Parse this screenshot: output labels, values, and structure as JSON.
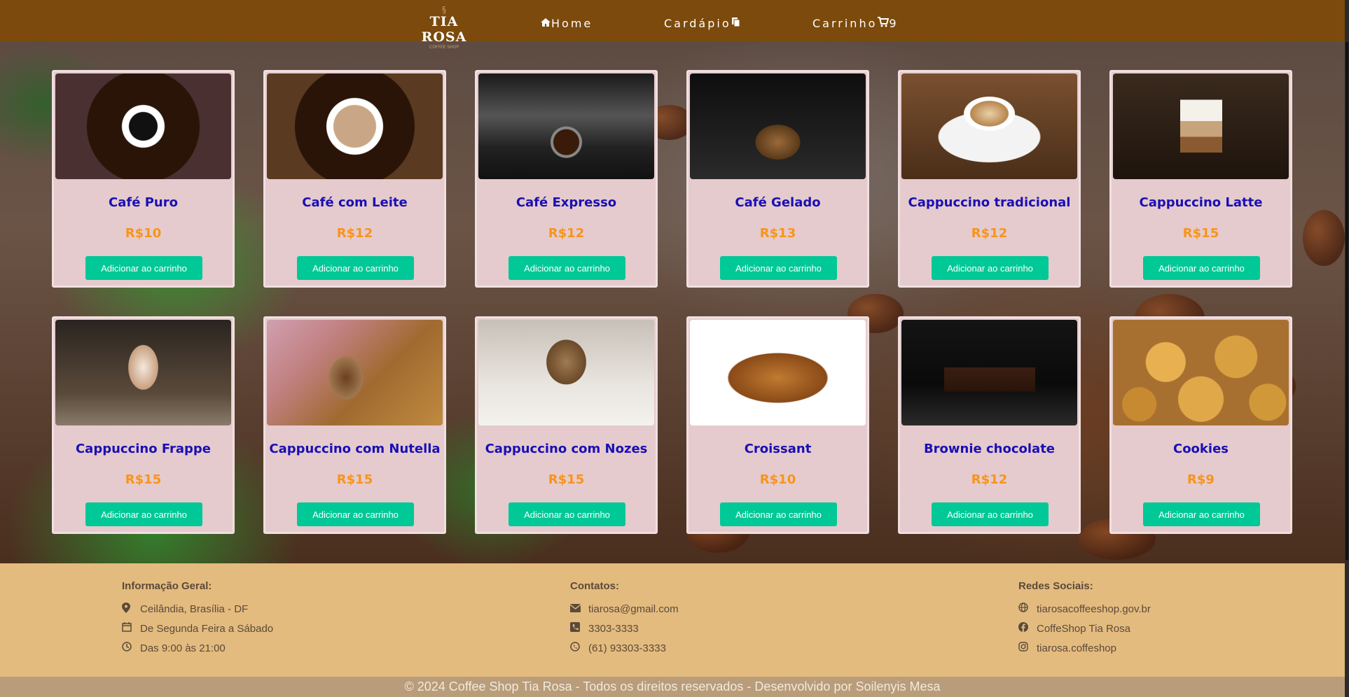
{
  "navbar": {
    "logo": "TIA ROSA",
    "logo_sub": "COFFEE SHOP",
    "links": {
      "home": "Home",
      "cardapio": "Cardápio",
      "carrinho": "Carrinho",
      "cart_count": "9"
    }
  },
  "products": [
    {
      "name": "Café Puro",
      "price": "R$10",
      "button": "Adicionar ao carrinho"
    },
    {
      "name": "Café com Leite",
      "price": "R$12",
      "button": "Adicionar ao carrinho"
    },
    {
      "name": "Café Expresso",
      "price": "R$12",
      "button": "Adicionar ao carrinho"
    },
    {
      "name": "Café Gelado",
      "price": "R$13",
      "button": "Adicionar ao carrinho"
    },
    {
      "name": "Cappuccino tradicional",
      "price": "R$12",
      "button": "Adicionar ao carrinho"
    },
    {
      "name": "Cappuccino Latte",
      "price": "R$15",
      "button": "Adicionar ao carrinho"
    },
    {
      "name": "Cappuccino Frappe",
      "price": "R$15",
      "button": "Adicionar ao carrinho"
    },
    {
      "name": "Cappuccino com Nutella",
      "price": "R$15",
      "button": "Adicionar ao carrinho"
    },
    {
      "name": "Cappuccino com Nozes",
      "price": "R$15",
      "button": "Adicionar ao carrinho"
    },
    {
      "name": "Croissant",
      "price": "R$10",
      "button": "Adicionar ao carrinho"
    },
    {
      "name": "Brownie chocolate",
      "price": "R$12",
      "button": "Adicionar ao carrinho"
    },
    {
      "name": "Cookies",
      "price": "R$9",
      "button": "Adicionar ao carrinho"
    }
  ],
  "footer": {
    "info": {
      "title": "Informação Geral:",
      "address": "Ceilândia, Brasília - DF",
      "days": "De Segunda Feira a Sábado",
      "hours": "Das 9:00 às 21:00"
    },
    "contacts": {
      "title": "Contatos:",
      "email": "tiarosa@gmail.com",
      "phone": "3303-3333",
      "whatsapp": "(61) 93303-3333"
    },
    "social": {
      "title": "Redes Sociais:",
      "website": "tiarosacoffeeshop.gov.br",
      "facebook": "CoffeShop Tia Rosa",
      "instagram": "tiarosa.coffeshop"
    },
    "copyright": "© 2024 Coffee Shop Tia Rosa - Todos os direitos reservados - Desenvolvido por Soilenyis Mesa"
  },
  "colors": {
    "navbar": "#7b4a0c",
    "card": "#e5cbcd",
    "product_name": "#1a0fb4",
    "price": "#f7941d",
    "button": "#00c896",
    "footer": "#e4bb7e"
  }
}
